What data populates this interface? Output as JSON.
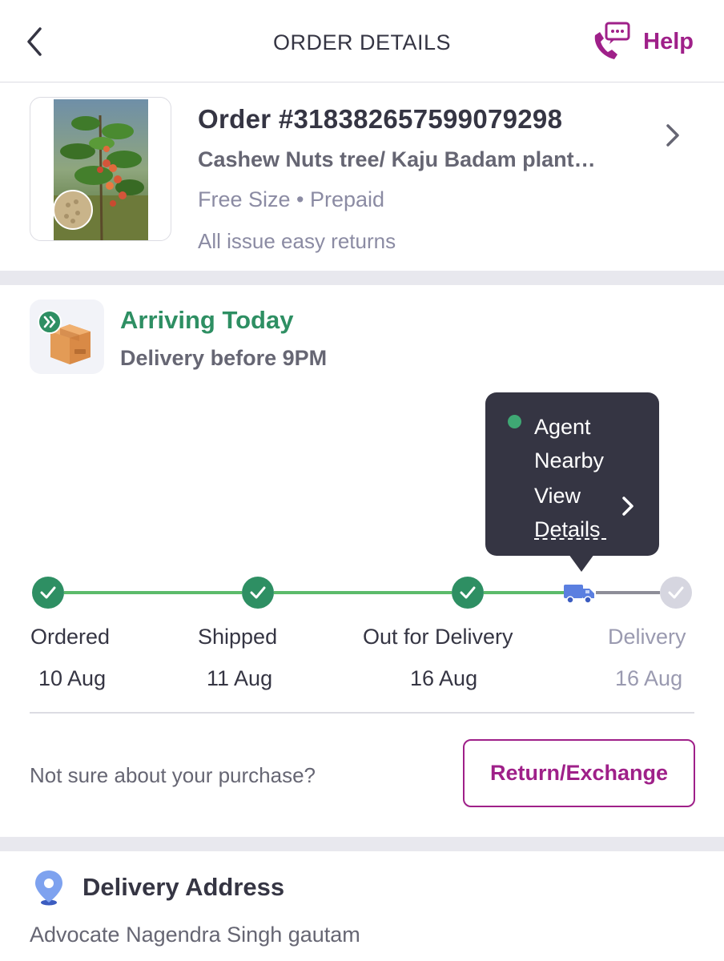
{
  "header": {
    "title": "ORDER DETAILS",
    "help_label": "Help"
  },
  "order": {
    "id_text": "Order #318382657599079298",
    "product_name": "Cashew Nuts tree/ Kaju Badam plant…",
    "size_payment": "Free Size • Prepaid",
    "returns_note": "All issue easy returns"
  },
  "arrival": {
    "title": "Arriving Today",
    "subtitle": "Delivery before 9PM"
  },
  "tooltip": {
    "agent_text": "Agent Nearby",
    "view_details_label": "View Details"
  },
  "tracker": {
    "steps": [
      {
        "label": "Ordered",
        "date": "10 Aug",
        "status": "done"
      },
      {
        "label": "Shipped",
        "date": "11 Aug",
        "status": "done"
      },
      {
        "label": "Out for Delivery",
        "date": "16 Aug",
        "status": "done"
      },
      {
        "label": "Delivery",
        "date": "16 Aug",
        "status": "pending"
      }
    ]
  },
  "returns": {
    "prompt": "Not sure about your purchase?",
    "button_label": "Return/Exchange"
  },
  "address": {
    "title": "Delivery Address",
    "name": "Advocate Nagendra Singh gautam"
  },
  "icons": {
    "back": "back-arrow-icon",
    "help": "support-chat-phone-icon",
    "chevron": "chevron-right-icon",
    "package": "package-box-icon",
    "truck": "delivery-truck-icon",
    "check": "checkmark-icon",
    "location": "location-pin-icon"
  },
  "colors": {
    "brand": "#9f2089",
    "success": "#2e8f63",
    "track_done": "#5cbb6b",
    "truck": "#5b7fe0",
    "text": "#353543",
    "muted": "#8b8ba3"
  }
}
